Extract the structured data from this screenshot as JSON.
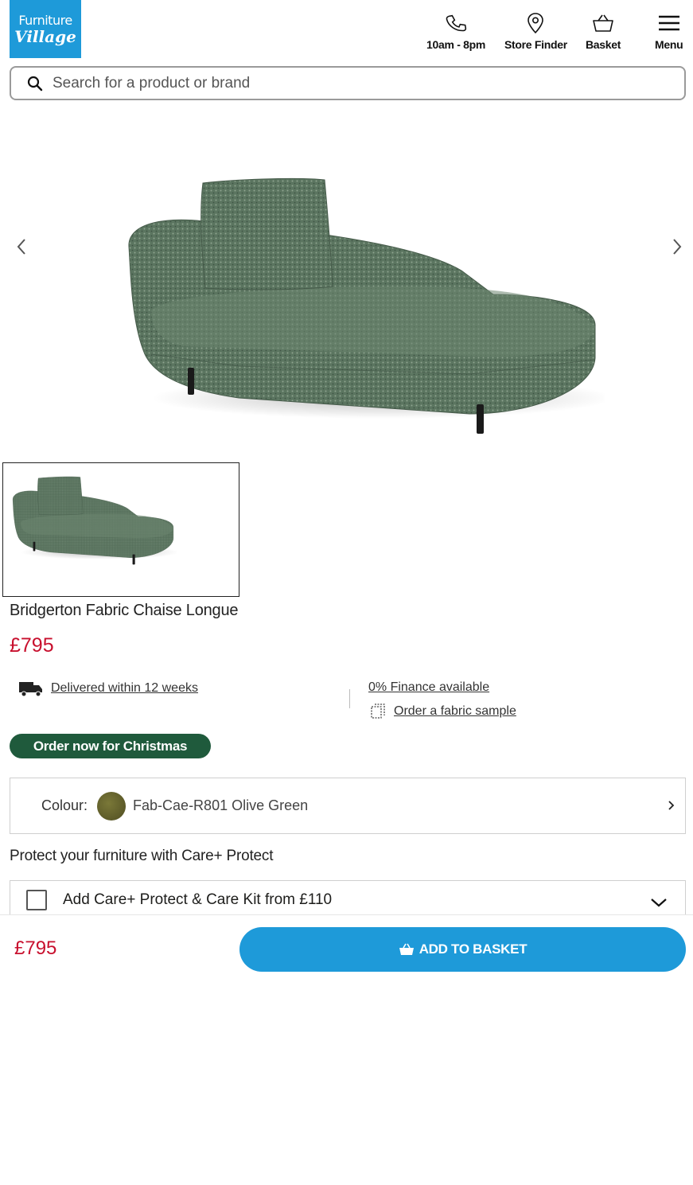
{
  "header": {
    "logo_line1": "Furniture",
    "logo_line2": "Village",
    "nav": [
      {
        "label": "10am - 8pm",
        "icon": "phone-icon"
      },
      {
        "label": "Store Finder",
        "icon": "location-pin-icon"
      },
      {
        "label": "Basket",
        "icon": "basket-icon"
      },
      {
        "label": "Menu",
        "icon": "hamburger-menu-icon"
      }
    ]
  },
  "search": {
    "placeholder": "Search for a product or brand",
    "icon": "search-icon"
  },
  "gallery": {
    "prev_icon": "chevron-left-icon",
    "next_icon": "chevron-right-icon"
  },
  "product": {
    "title": "Bridgerton Fabric Chaise Longue",
    "price": "£795",
    "delivery": "Delivered within 12 weeks",
    "finance": "0% Finance available",
    "sample": "Order a fabric sample",
    "badge": "Order now for Christmas"
  },
  "colour": {
    "label": "Colour:",
    "value": "Fab-Cae-R801 Olive Green",
    "swatch_color": "#5f5d2c"
  },
  "care": {
    "title": "Protect your furniture with Care+ Protect",
    "option": "Add Care+ Protect & Care Kit from £110"
  },
  "sticky": {
    "price": "£795",
    "button": "ADD TO BASKET"
  },
  "colors": {
    "brand_blue": "#1e9ad9",
    "price_red": "#c8102e",
    "badge_green": "#1f5a3c",
    "sofa_green": "#5b7560"
  }
}
